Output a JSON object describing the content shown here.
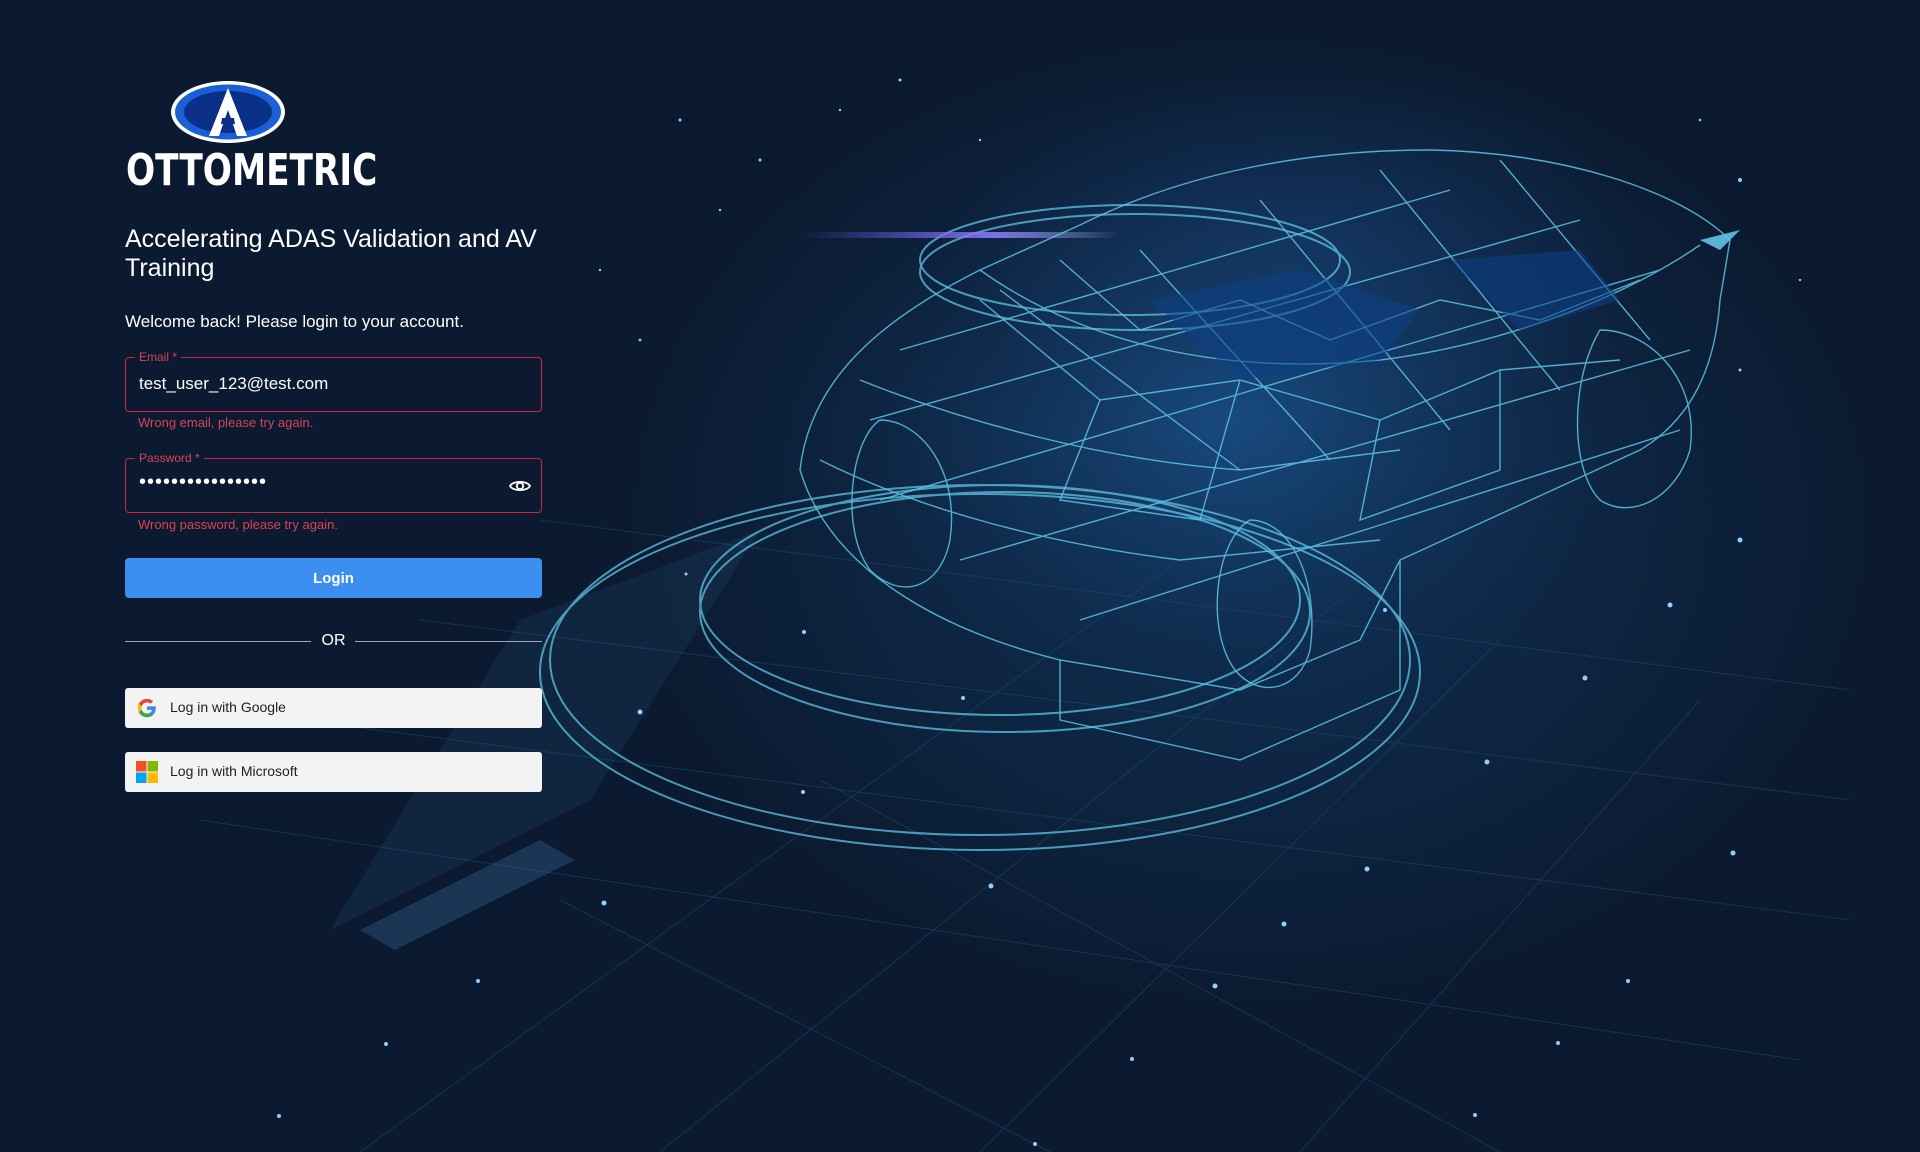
{
  "brand": {
    "name": "OTTOMETRIC",
    "tagline": "Accelerating ADAS Validation and AV Training"
  },
  "login": {
    "welcome": "Welcome back! Please login to your account.",
    "email": {
      "label": "Email *",
      "value": "test_user_123@test.com",
      "error": "Wrong email, please try again."
    },
    "password": {
      "label": "Password *",
      "masked_value": "••••••••••••••••",
      "error": "Wrong password, please try again."
    },
    "login_button": "Login",
    "divider_text": "OR",
    "google_button": "Log in with Google",
    "microsoft_button": "Log in with Microsoft"
  },
  "colors": {
    "background": "#0b1a30",
    "accent": "#3c8ff0",
    "error": "#d94454",
    "wireframe": "#5fc4e6"
  },
  "icons": {
    "logo": "ottometric-logo-icon",
    "password_toggle": "eye-icon",
    "google": "google-icon",
    "microsoft": "microsoft-icon"
  }
}
